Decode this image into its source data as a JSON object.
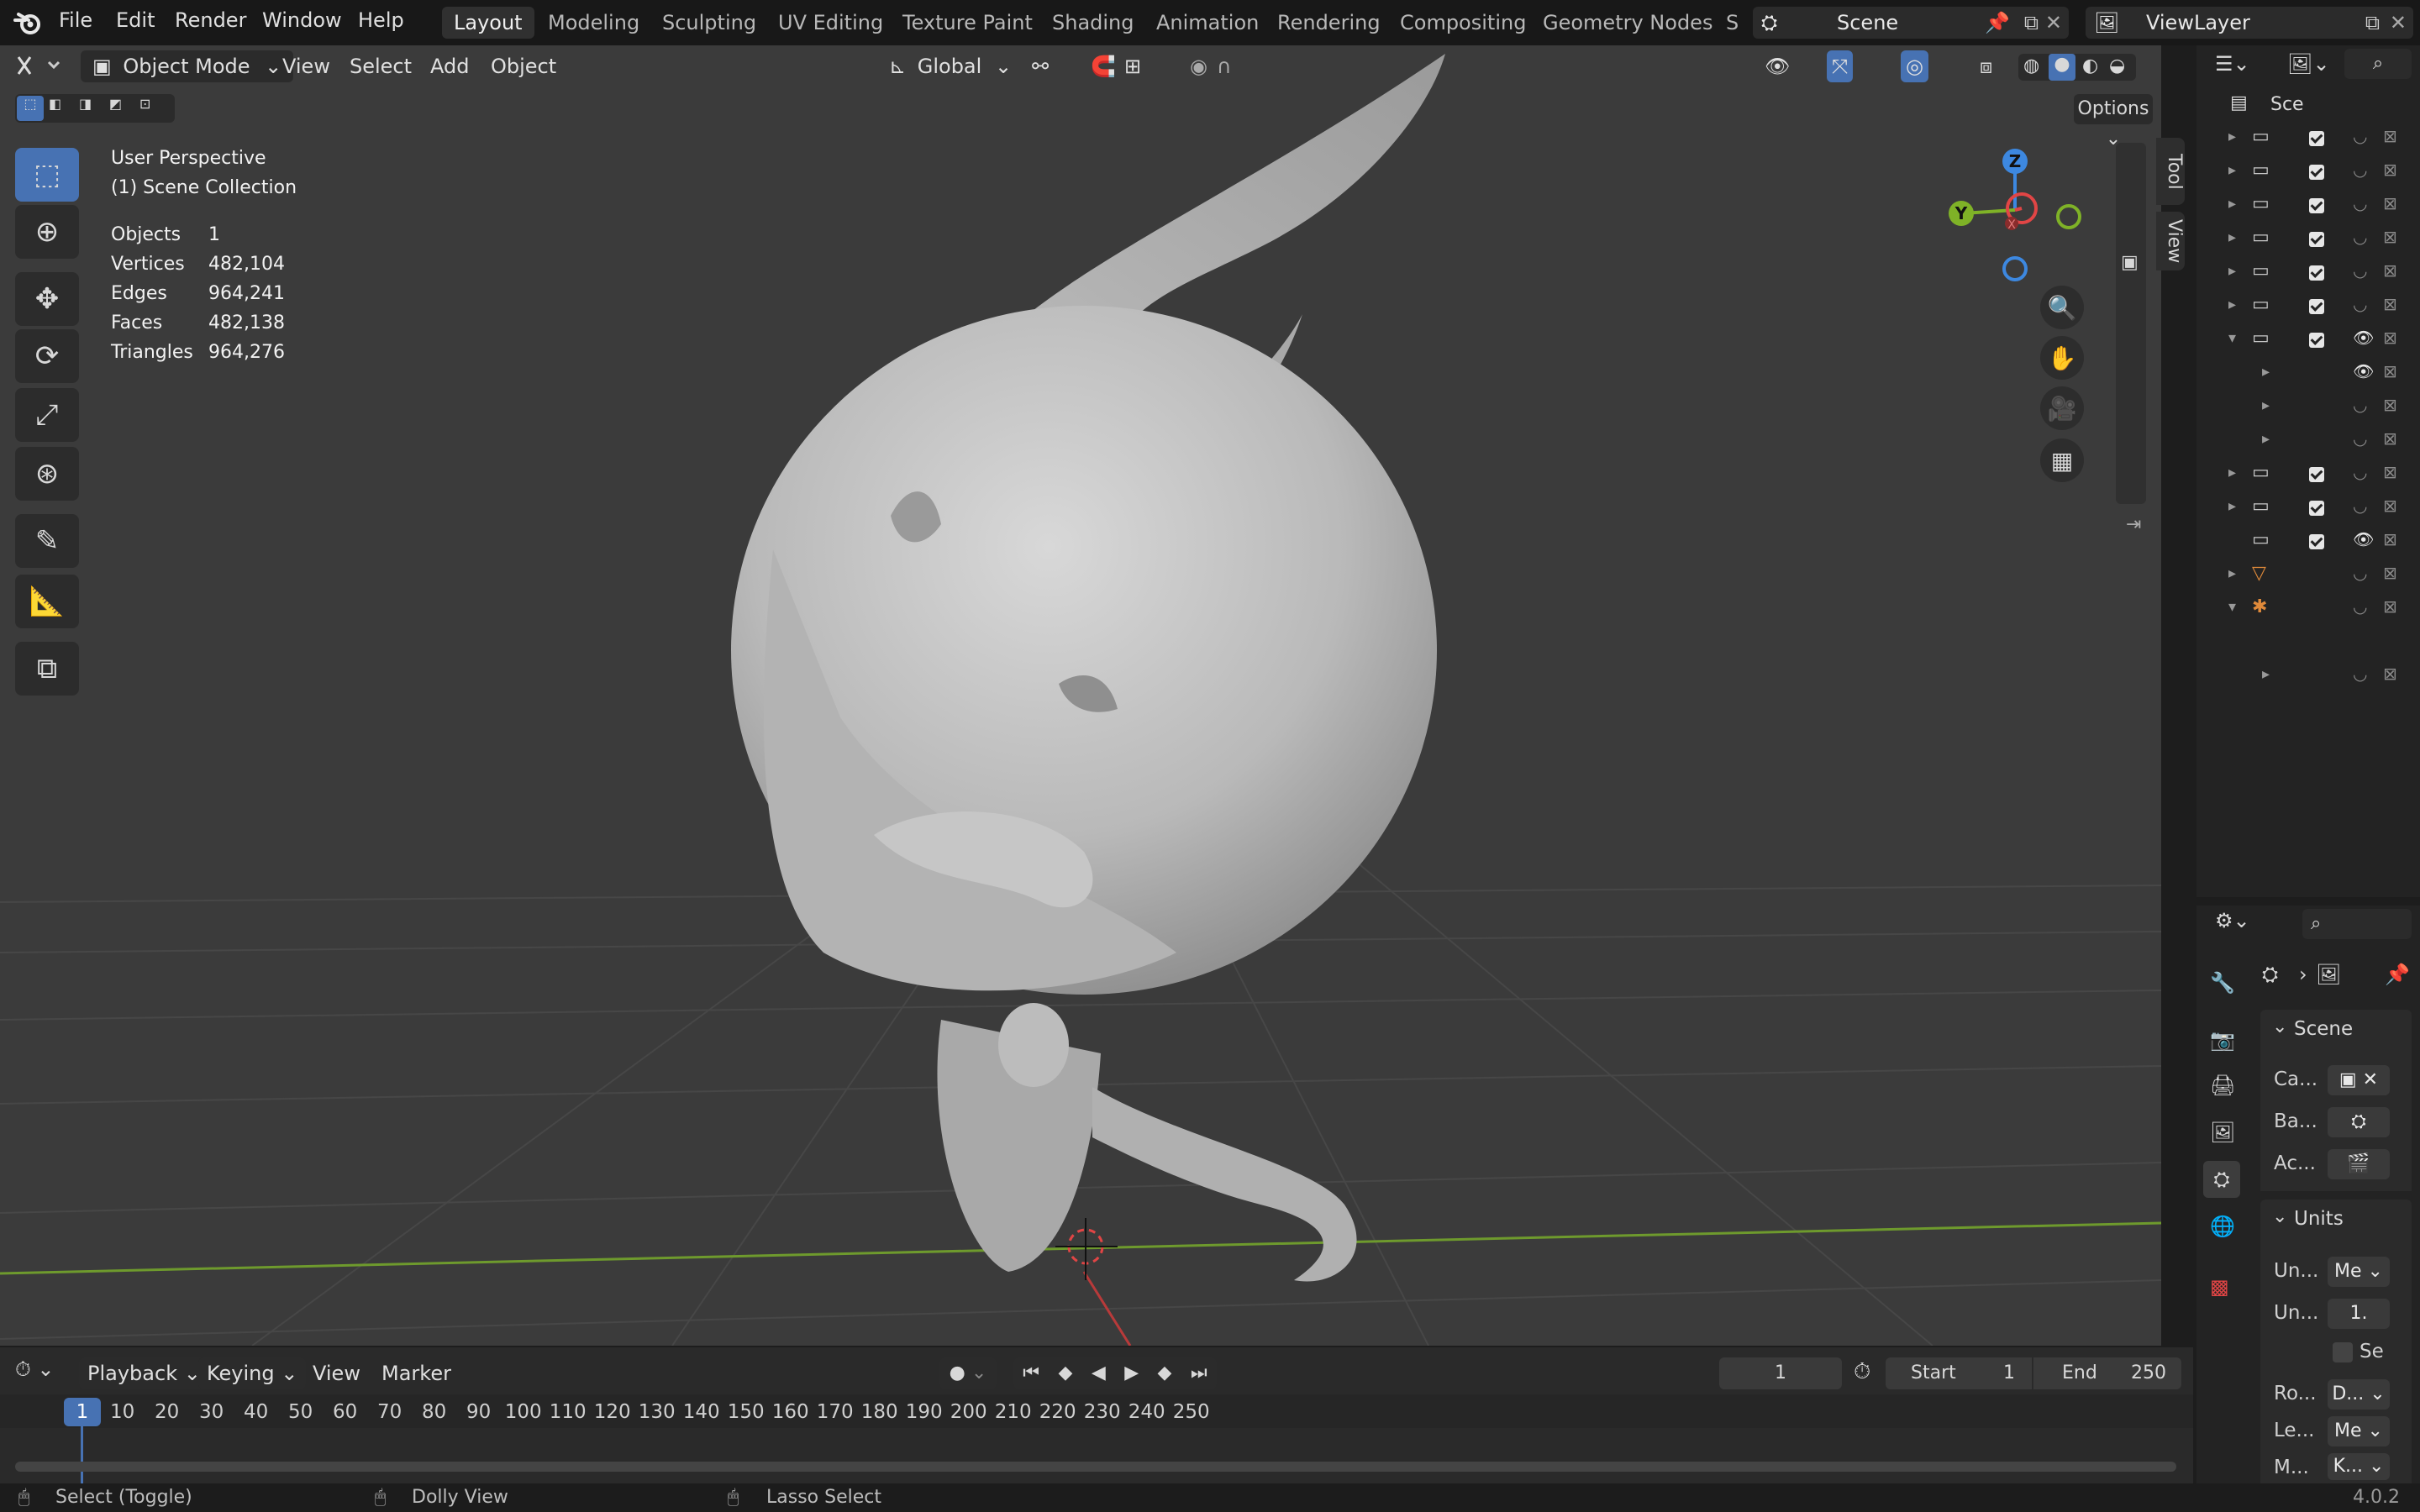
{
  "menu": {
    "file": "File",
    "edit": "Edit",
    "render": "Render",
    "window": "Window",
    "help": "Help"
  },
  "workspaces": [
    "Layout",
    "Modeling",
    "Sculpting",
    "UV Editing",
    "Texture Paint",
    "Shading",
    "Animation",
    "Rendering",
    "Compositing",
    "Geometry Nodes",
    "S"
  ],
  "scene": {
    "name": "Scene"
  },
  "view_layer": {
    "name": "ViewLayer"
  },
  "viewport_header": {
    "mode": "Object Mode",
    "view": "View",
    "select": "Select",
    "add": "Add",
    "object": "Object",
    "orientation": "Global",
    "options": "Options"
  },
  "overlay_info": {
    "perspective": "User Perspective",
    "collection": "(1) Scene Collection"
  },
  "stats": [
    {
      "label": "Objects",
      "value": "1"
    },
    {
      "label": "Vertices",
      "value": "482,104"
    },
    {
      "label": "Edges",
      "value": "964,241"
    },
    {
      "label": "Faces",
      "value": "482,138"
    },
    {
      "label": "Triangles",
      "value": "964,276"
    }
  ],
  "gizmo": {
    "z": "Z",
    "y": "Y",
    "x": "X"
  },
  "side_tabs": {
    "tool": "Tool",
    "view": "View"
  },
  "timeline": {
    "playback": "Playback",
    "keying": "Keying",
    "view": "View",
    "marker": "Marker",
    "current_frame": "1",
    "start_label": "Start",
    "start": "1",
    "end_label": "End",
    "end": "250",
    "ticks": [
      "1",
      "10",
      "20",
      "30",
      "40",
      "50",
      "60",
      "70",
      "80",
      "90",
      "100",
      "110",
      "120",
      "130",
      "140",
      "150",
      "160",
      "170",
      "180",
      "190",
      "200",
      "210",
      "220",
      "230",
      "240",
      "250"
    ]
  },
  "status": {
    "select": "Select (Toggle)",
    "dolly": "Dolly View",
    "lasso": "Lasso Select",
    "version": "4.0.2"
  },
  "outliner": {
    "header": "Sce"
  },
  "properties": {
    "scene_panel": "Scene",
    "camera_label": "Ca...",
    "background_label": "Ba...",
    "active_clip_label": "Ac...",
    "units_panel": "Units",
    "unit_system_label": "Un...",
    "unit_system_value": "Me",
    "unit_scale_label": "Un...",
    "unit_scale_value": "1.",
    "separate_units_label": "Se",
    "rotation_label": "Ro...",
    "rotation_value": "D...",
    "length_label": "Le...",
    "length_value": "Me",
    "mass_label": "M...",
    "mass_value": "K..."
  },
  "colors": {
    "accent": "#4772b3",
    "x_axis": "#e14545",
    "y_axis": "#7fb227",
    "z_axis": "#3d88e0"
  }
}
